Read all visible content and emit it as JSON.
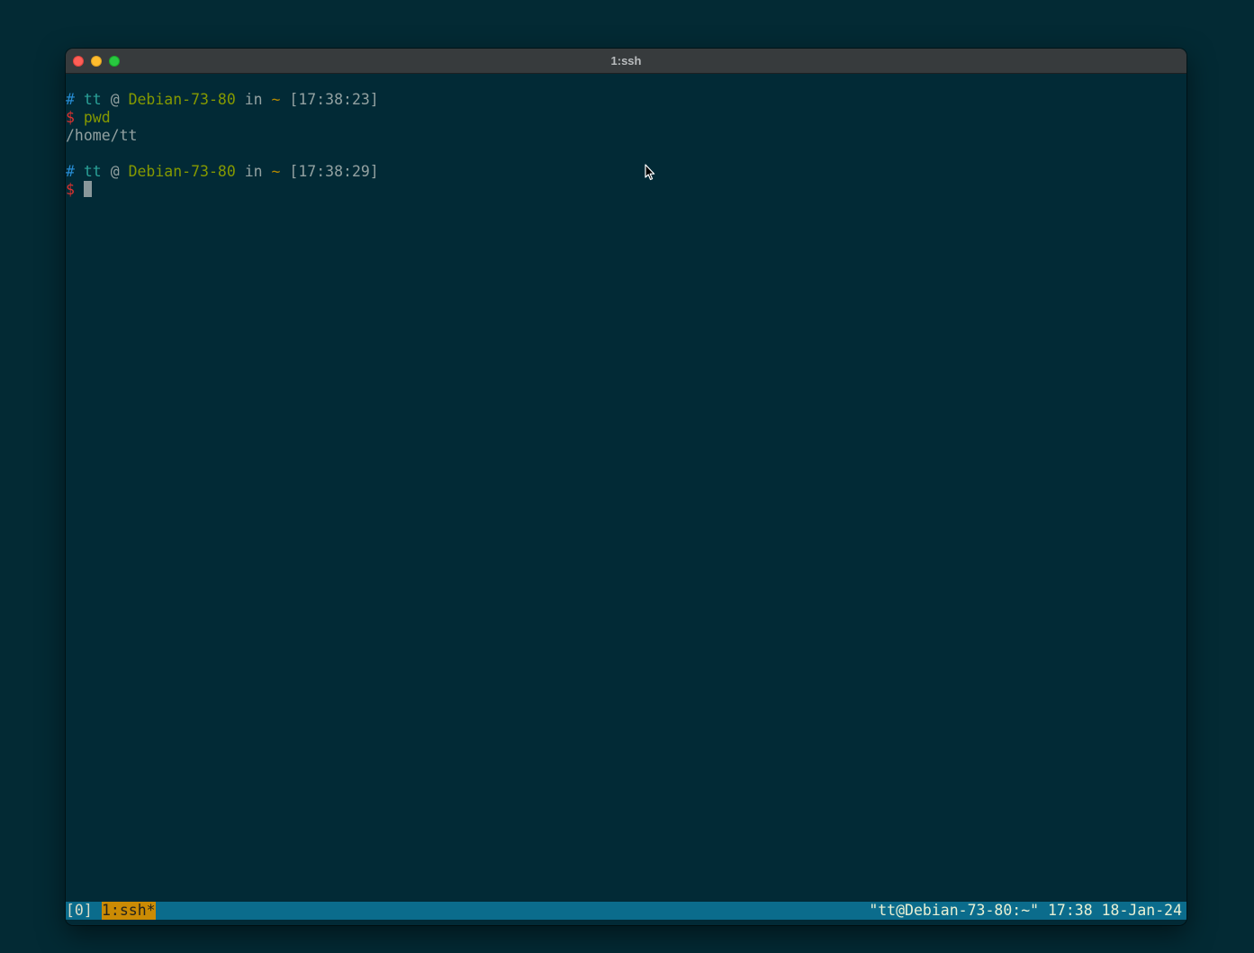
{
  "window": {
    "title": "1:ssh"
  },
  "terminal": {
    "lines": [
      {
        "hash": "#",
        "user": "tt",
        "at": "@",
        "host": "Debian-73-80",
        "in": "in",
        "dir": "~",
        "time": "[17:38:23]"
      },
      {
        "prompt": "$",
        "command": "pwd"
      },
      {
        "output": "/home/tt"
      },
      {
        "hash": "#",
        "user": "tt",
        "at": "@",
        "host": "Debian-73-80",
        "in": "in",
        "dir": "~",
        "time": "[17:38:29]"
      },
      {
        "prompt": "$"
      }
    ]
  },
  "statusbar": {
    "session": "[0]",
    "window": "1:ssh*",
    "right": "\"tt@Debian-73-80:~\" 17:38 18-Jan-24"
  },
  "colors": {
    "desktop": "#032a34",
    "terminal_bg": "#022a36",
    "statusbar_bg": "#0b6c8c",
    "active_window_bg": "#cb8b04",
    "blue": "#268bd2",
    "cyan": "#2aa198",
    "yellow": "#b58900",
    "green": "#859900",
    "red": "#dc322f"
  },
  "icons": {
    "pointer": "mouse-pointer-icon"
  }
}
